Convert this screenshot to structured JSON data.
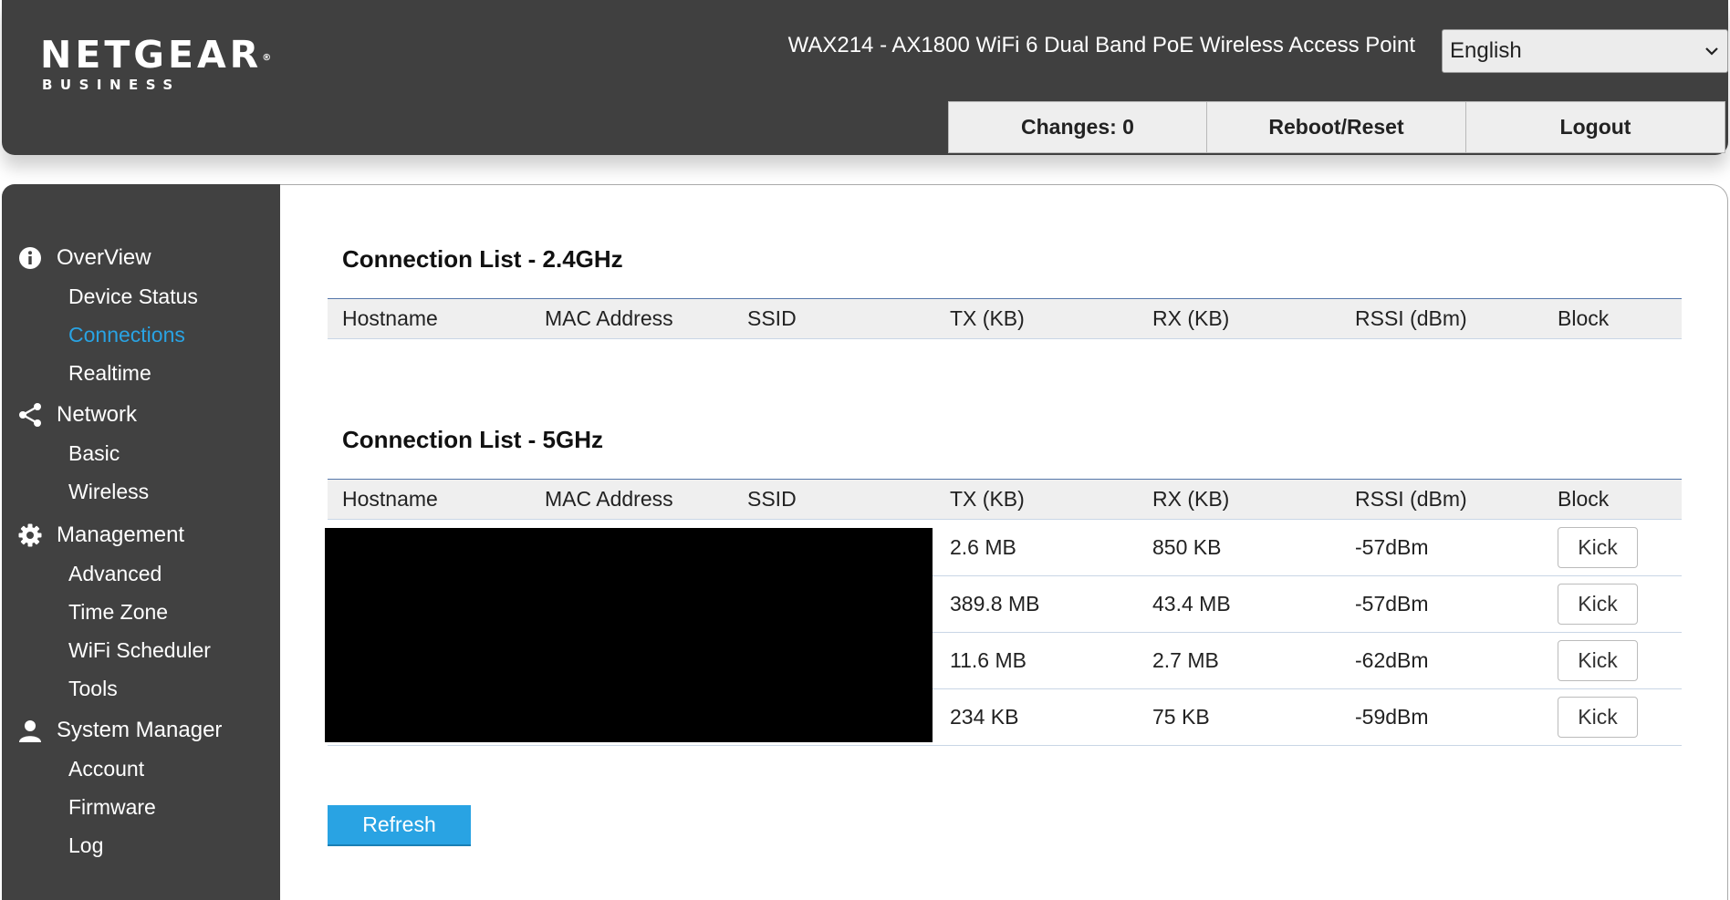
{
  "header": {
    "logo_main": "NETGEAR",
    "logo_reg": "®",
    "logo_sub": "BUSINESS",
    "product_title": "WAX214 - AX1800 WiFi 6 Dual Band PoE Wireless Access Point",
    "language": {
      "selected": "English",
      "icon": "chevron-down-icon"
    },
    "buttons": {
      "changes": "Changes: 0",
      "reboot": "Reboot/Reset",
      "logout": "Logout"
    }
  },
  "sidebar": {
    "groups": [
      {
        "label": "OverView",
        "icon": "info-icon",
        "items": [
          {
            "label": "Device Status"
          },
          {
            "label": "Connections",
            "active": true
          },
          {
            "label": "Realtime"
          }
        ]
      },
      {
        "label": "Network",
        "icon": "share-icon",
        "items": [
          {
            "label": "Basic"
          },
          {
            "label": "Wireless"
          }
        ]
      },
      {
        "label": "Management",
        "icon": "gear-icon",
        "items": [
          {
            "label": "Advanced"
          },
          {
            "label": "Time Zone"
          },
          {
            "label": "WiFi Scheduler"
          },
          {
            "label": "Tools"
          }
        ]
      },
      {
        "label": "System Manager",
        "icon": "user-icon",
        "items": [
          {
            "label": "Account"
          },
          {
            "label": "Firmware"
          },
          {
            "label": "Log"
          }
        ]
      }
    ]
  },
  "main": {
    "list_24": {
      "title": "Connection List - 2.4GHz",
      "columns": [
        "Hostname",
        "MAC Address",
        "SSID",
        "TX (KB)",
        "RX (KB)",
        "RSSI (dBm)",
        "Block"
      ]
    },
    "list_5": {
      "title": "Connection List - 5GHz",
      "columns": [
        "Hostname",
        "MAC Address",
        "SSID",
        "TX (KB)",
        "RX (KB)",
        "RSSI (dBm)",
        "Block"
      ],
      "rows": [
        {
          "tx": "2.6 MB",
          "rx": "850 KB",
          "rssi": "-57dBm",
          "action": "Kick"
        },
        {
          "tx": "389.8 MB",
          "rx": "43.4 MB",
          "rssi": "-57dBm",
          "action": "Kick"
        },
        {
          "tx": "11.6 MB",
          "rx": "2.7 MB",
          "rssi": "-62dBm",
          "action": "Kick"
        },
        {
          "tx": "234 KB",
          "rx": "75 KB",
          "rssi": "-59dBm",
          "action": "Kick"
        }
      ]
    },
    "refresh_label": "Refresh"
  },
  "colors": {
    "accent": "#29a3e3",
    "header_bg": "#404040",
    "sidebar_bg": "#414141"
  }
}
